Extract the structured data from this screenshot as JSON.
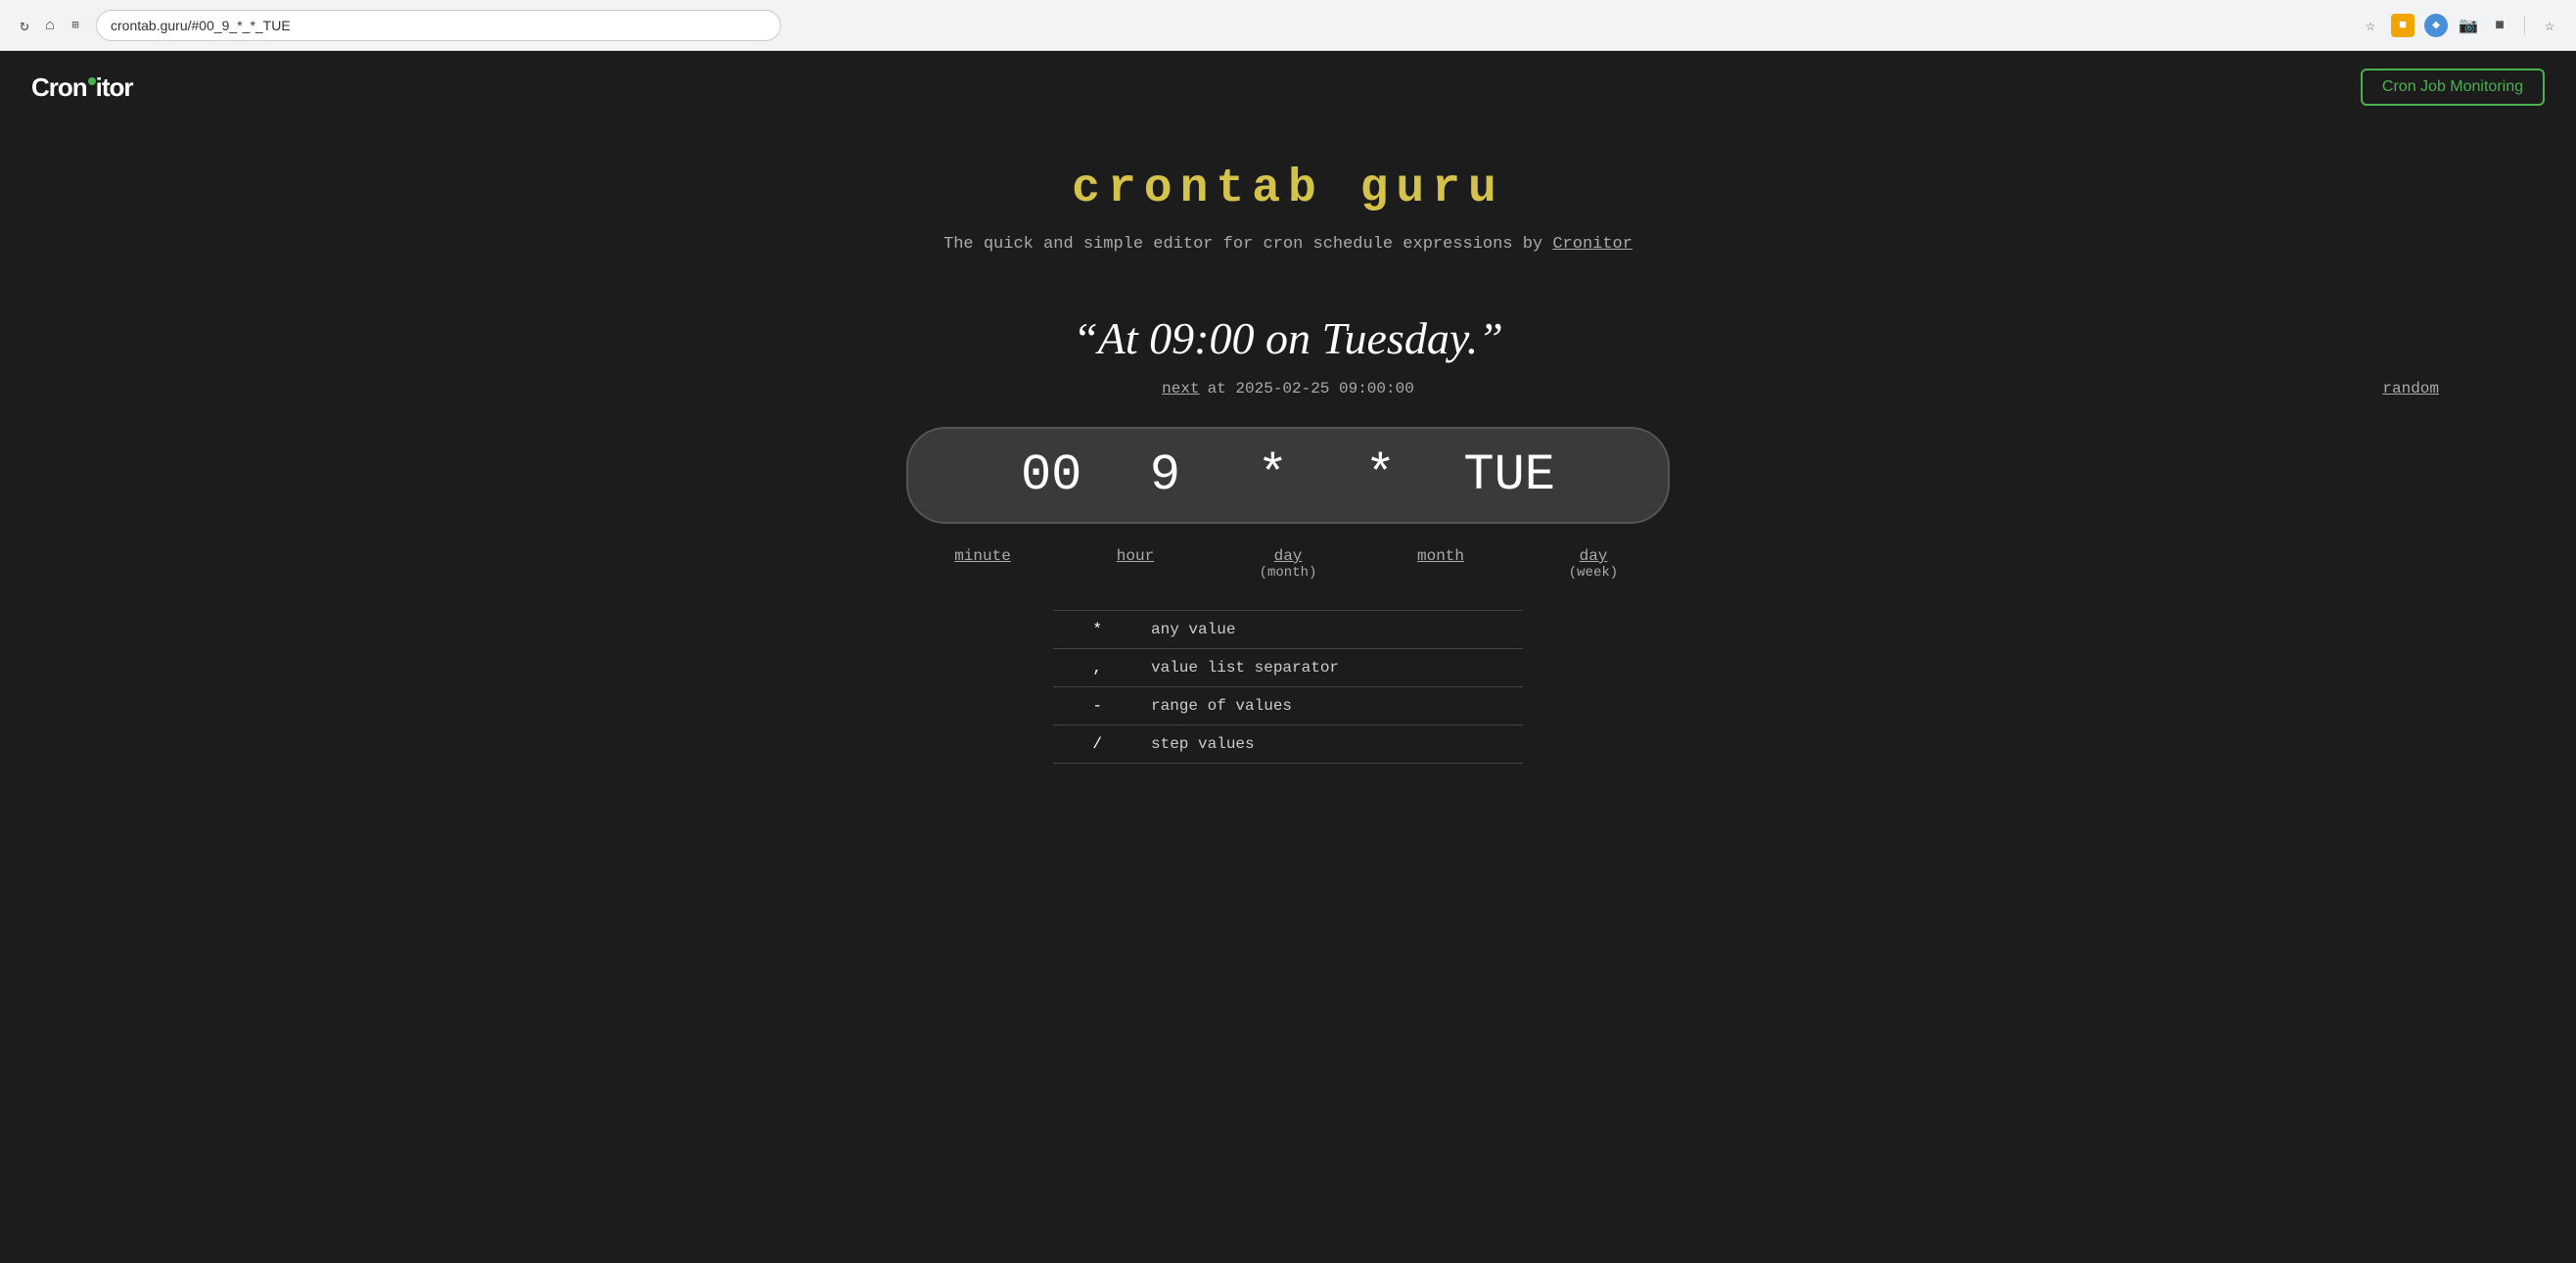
{
  "browser": {
    "url": "crontab.guru/#00_9_*_*_TUE",
    "reload_icon": "↻",
    "home_icon": "⌂",
    "tabs_icon": "⊞"
  },
  "navbar": {
    "logo_text": "Cronitor",
    "cron_job_btn": "Cron Job Monitoring"
  },
  "main": {
    "title": "crontab  guru",
    "subtitle_text": "The quick and simple editor for cron schedule expressions by",
    "subtitle_link": "Cronitor",
    "schedule_description": "“At 09:00 on Tuesday.”",
    "next_label": "next",
    "next_datetime": "at 2025-02-25 09:00:00",
    "random_link": "random",
    "cron_fields": {
      "minute": "00",
      "hour": "9",
      "day_month": "*",
      "month": "*",
      "day_week": "TUE"
    },
    "field_labels": [
      {
        "label": "minute",
        "sub": ""
      },
      {
        "label": "hour",
        "sub": ""
      },
      {
        "label": "day",
        "sub": "(month)"
      },
      {
        "label": "month",
        "sub": ""
      },
      {
        "label": "day",
        "sub": "(week)"
      }
    ],
    "reference_rows": [
      {
        "symbol": "*",
        "description": "any value"
      },
      {
        "symbol": ",",
        "description": "value list separator"
      },
      {
        "symbol": "-",
        "description": "range of values"
      },
      {
        "symbol": "/",
        "description": "step values"
      }
    ]
  }
}
